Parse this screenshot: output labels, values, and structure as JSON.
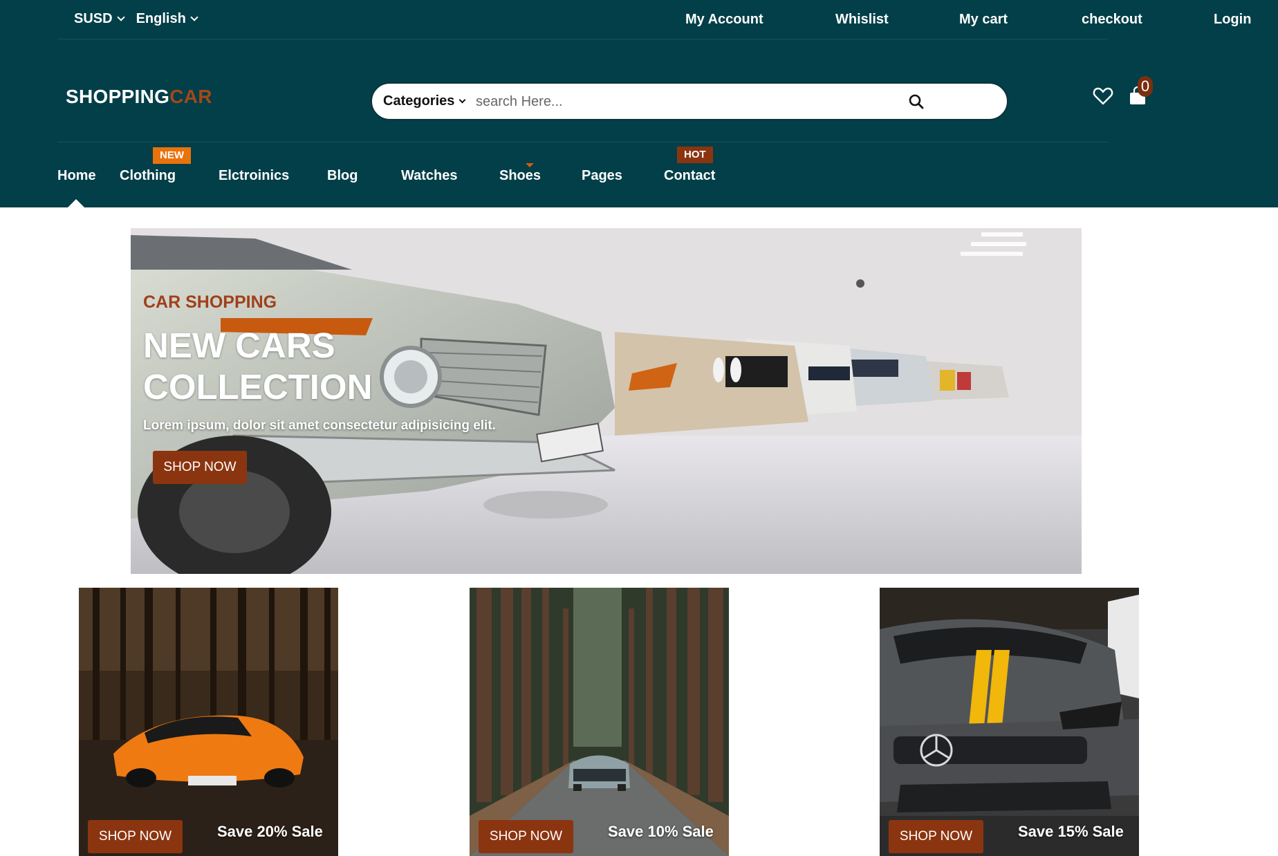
{
  "topbar": {
    "currency": "SUSD",
    "language": "English",
    "links": [
      "My Account",
      "Whislist",
      "My cart",
      "checkout",
      "Login"
    ]
  },
  "brand": {
    "name_main": "SHOPPING",
    "name_accent": "CAR",
    "accent_color": "#a34818"
  },
  "search": {
    "category_label": "Categories",
    "placeholder": "search Here..."
  },
  "cart": {
    "count": "0"
  },
  "nav": {
    "items": [
      "Home",
      "Clothing",
      "Elctroinics",
      "Blog",
      "Watches",
      "Shoes",
      "Pages",
      "Contact"
    ],
    "badges": {
      "clothing": "NEW",
      "contact": "HOT"
    }
  },
  "hero": {
    "kicker": "CAR SHOPPING",
    "title": "NEW CARS COLLECTION",
    "text": "Lorem ipsum, dolor sit amet consectetur adipisicing elit.",
    "button": "SHOP NOW"
  },
  "cards": [
    {
      "button": "SHOP NOW",
      "sale": "Save 20% Sale"
    },
    {
      "button": "SHOP NOW",
      "sale": "Save 10% Sale"
    },
    {
      "button": "SHOP NOW",
      "sale": "Save 15% Sale"
    }
  ],
  "icons": {
    "chevron": "chevron-down-icon",
    "search": "search-icon",
    "wishlist": "heart-icon",
    "cart": "shopping-bag-icon"
  },
  "colors": {
    "header_bg": "#023f48",
    "button_bg": "#8b3510",
    "badge_new": "#e8730d",
    "badge_hot": "#8b3510"
  }
}
